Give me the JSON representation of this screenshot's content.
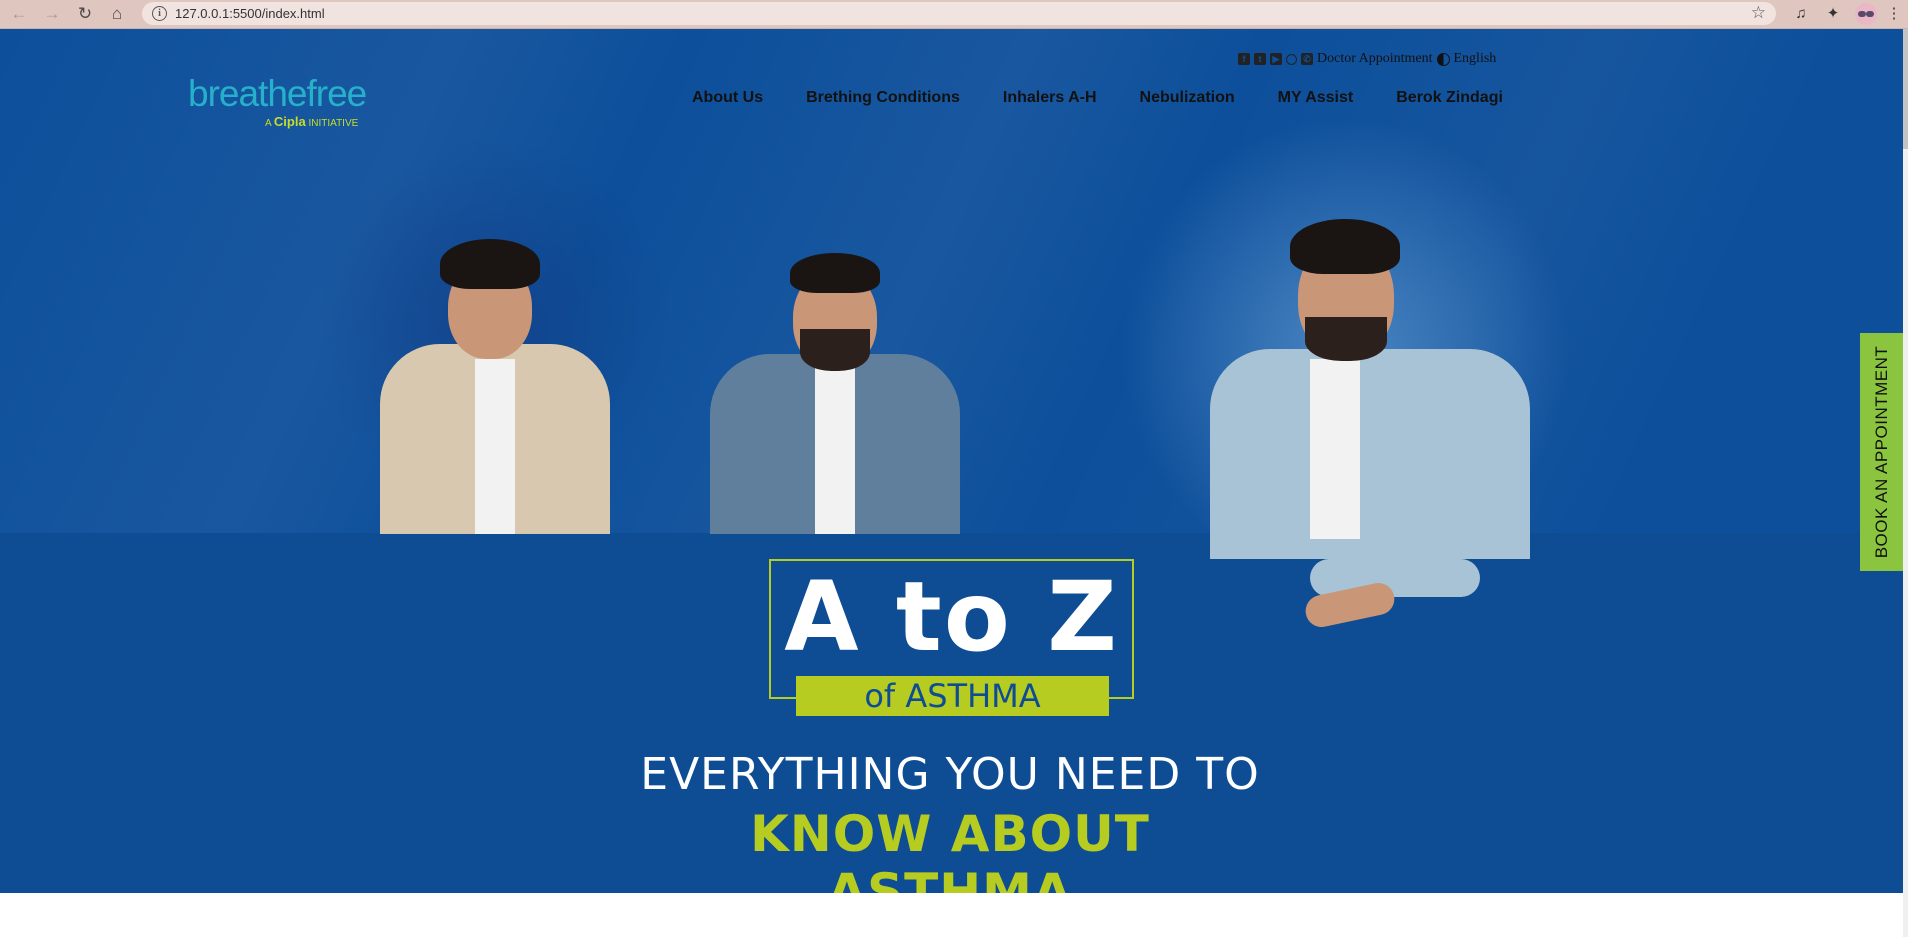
{
  "browser": {
    "url": "127.0.0.1:5500/index.html"
  },
  "site": {
    "logo": {
      "word": "breathefree",
      "sub_prefix": "A",
      "sub_brand": "Cipla",
      "sub_suffix": "INITIATIVE"
    },
    "topbar": {
      "doctor_appointment": "Doctor Appointment",
      "language": "English",
      "icons": [
        "facebook-icon",
        "twitter-icon",
        "youtube-icon",
        "instagram-icon",
        "phone-icon",
        "contrast-icon"
      ]
    },
    "nav": [
      {
        "label": "About Us"
      },
      {
        "label": "Brething Conditions"
      },
      {
        "label": "Inhalers A-H"
      },
      {
        "label": "Nebulization"
      },
      {
        "label": "MY Assist"
      },
      {
        "label": "Berok Zindagi"
      }
    ],
    "hero": {
      "title": "A to Z",
      "subtitle": "of ASTHMA",
      "tagline_1": "EVERYTHING YOU NEED TO",
      "tagline_2": "KNOW ABOUT ASTHMA"
    },
    "book_tab": "BOOK AN APPOINTMENT"
  },
  "colors": {
    "hero_blue": "#0d4f9b",
    "accent_green": "#b6cc21",
    "tab_green": "#8bc53f"
  }
}
